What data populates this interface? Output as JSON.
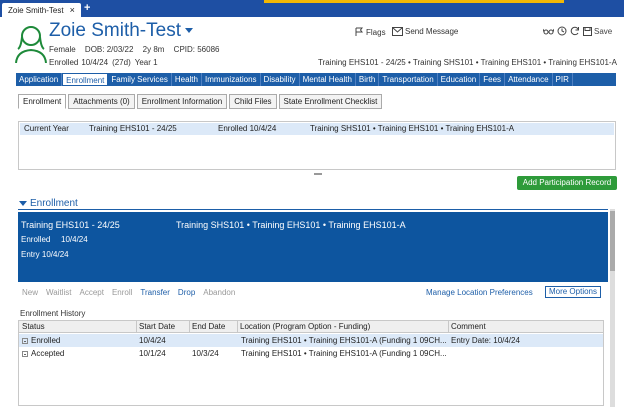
{
  "window": {
    "tab_label": "Zoie Smith-Test",
    "close_glyph": "×",
    "new_tab_glyph": "+"
  },
  "child": {
    "name": "Zoie Smith-Test",
    "gender": "Female",
    "dob": "DOB: 2/03/22",
    "age": "2y 8m",
    "cpid": "CPID: 56086",
    "enrolled": "Enrolled",
    "enrolled_date": "10/4/24",
    "days": "(27d)",
    "year": "Year 1"
  },
  "header_actions": {
    "flags": "Flags",
    "send_message": "Send Message",
    "save": "Save",
    "program_line": "Training EHS101 - 24/25 • Training SHS101 • Training EHS101 • Training EHS101-A"
  },
  "nav": [
    "Application",
    "Enrollment",
    "Family Services",
    "Health",
    "Immunizations",
    "Disability",
    "Mental Health",
    "Birth",
    "Transportation",
    "Education",
    "Fees",
    "Attendance",
    "PIR"
  ],
  "nav_active_index": 1,
  "subtabs": [
    "Enrollment",
    "Attachments (0)",
    "Enrollment Information",
    "Child Files",
    "State Enrollment Checklist"
  ],
  "current_year": {
    "label": "Current Year",
    "program": "Training EHS101 - 24/25",
    "status": "Enrolled 10/4/24",
    "sites": "Training SHS101 • Training EHS101 • Training EHS101-A"
  },
  "add_button": "Add Participation Record",
  "section": {
    "title": "Enrollment",
    "program": "Training EHS101 - 24/25",
    "sites": "Training SHS101 • Training EHS101 • Training EHS101-A",
    "status": "Enrolled",
    "status_date": "10/4/24",
    "entry": "Entry 10/4/24"
  },
  "actions": [
    {
      "label": "New",
      "enabled": false
    },
    {
      "label": "Waitlist",
      "enabled": false
    },
    {
      "label": "Accept",
      "enabled": false
    },
    {
      "label": "Enroll",
      "enabled": false
    },
    {
      "label": "Transfer",
      "enabled": true
    },
    {
      "label": "Drop",
      "enabled": true
    },
    {
      "label": "Abandon",
      "enabled": false
    }
  ],
  "manage_link": "Manage Location Preferences",
  "more_options": "More Options",
  "history": {
    "title": "Enrollment History",
    "columns": [
      "Status",
      "Start Date",
      "End Date",
      "Location (Program Option - Funding)",
      "Comment"
    ],
    "rows": [
      {
        "status": "Enrolled",
        "start": "10/4/24",
        "end": "",
        "location": "Training EHS101 • Training EHS101-A (Funding 1 09CH...",
        "comment": "Entry Date: 10/4/24"
      },
      {
        "status": "Accepted",
        "start": "10/1/24",
        "end": "10/3/24",
        "location": "Training EHS101 • Training EHS101-A (Funding 1 09CH...",
        "comment": ""
      }
    ]
  }
}
